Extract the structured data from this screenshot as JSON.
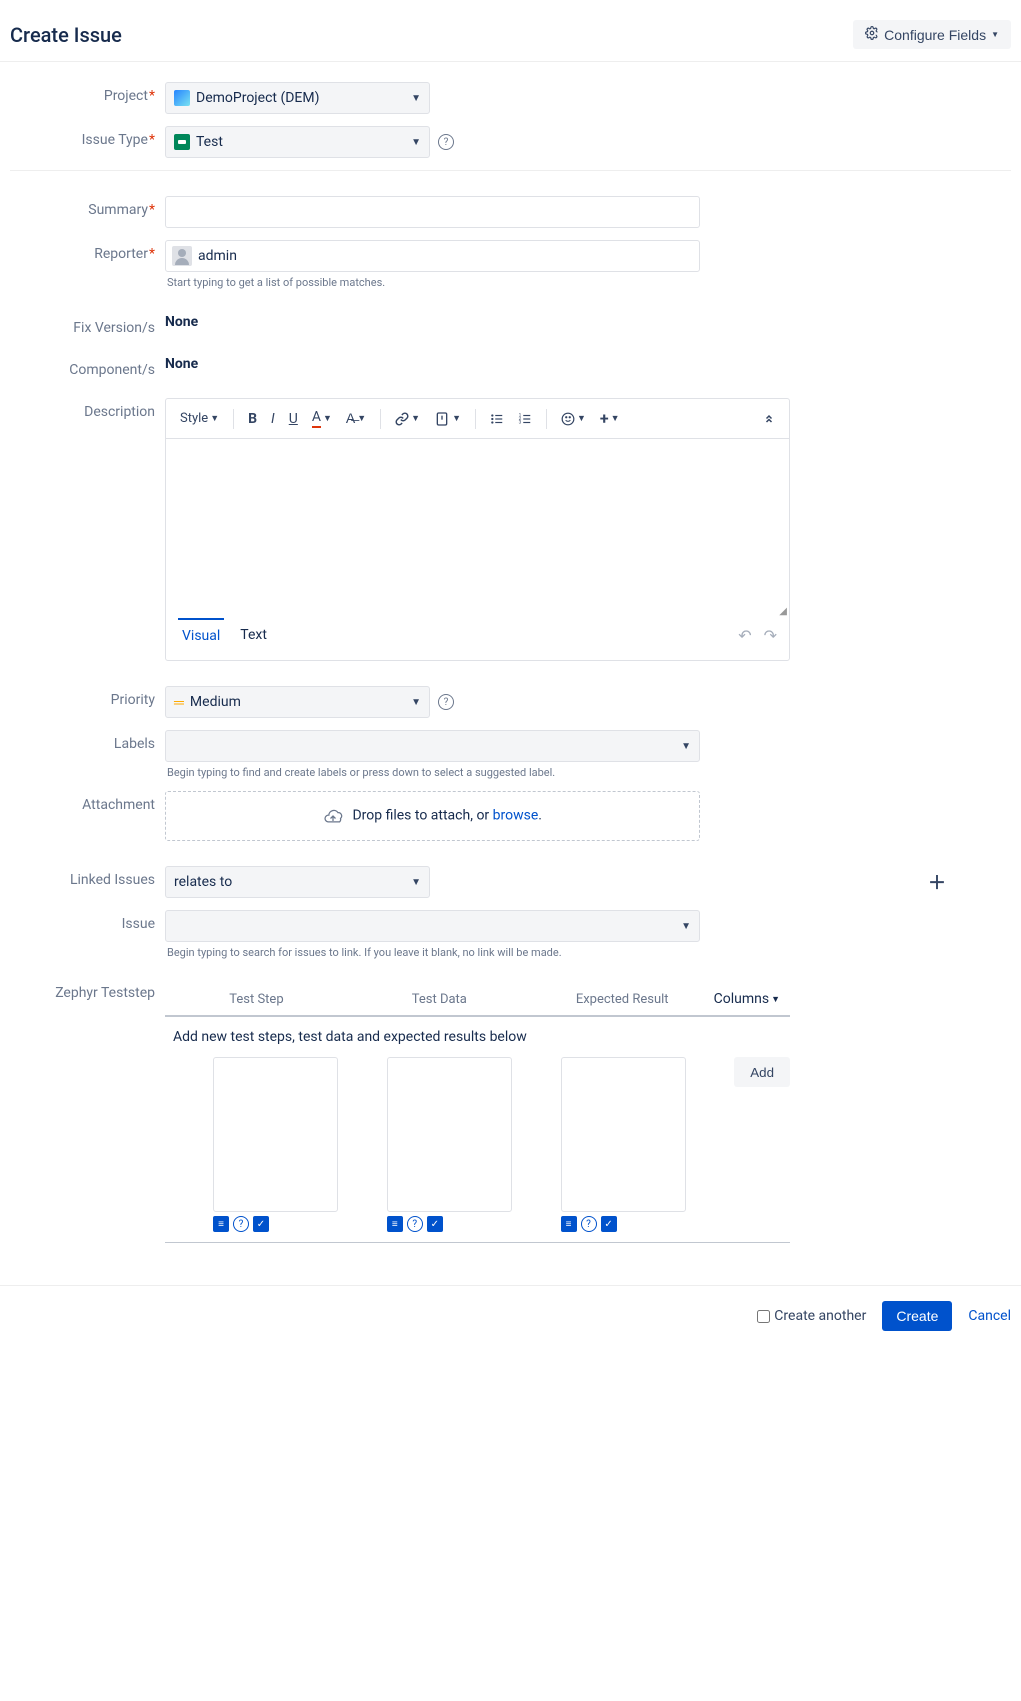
{
  "header": {
    "title": "Create Issue",
    "configure_fields": "Configure Fields"
  },
  "fields": {
    "project": {
      "label": "Project",
      "value": "DemoProject (DEM)"
    },
    "issue_type": {
      "label": "Issue Type",
      "value": "Test"
    },
    "summary": {
      "label": "Summary",
      "value": ""
    },
    "reporter": {
      "label": "Reporter",
      "value": "admin",
      "help": "Start typing to get a list of possible matches."
    },
    "fix_versions": {
      "label": "Fix Version/s",
      "value": "None"
    },
    "components": {
      "label": "Component/s",
      "value": "None"
    },
    "description": {
      "label": "Description"
    },
    "priority": {
      "label": "Priority",
      "value": "Medium"
    },
    "labels": {
      "label": "Labels",
      "help": "Begin typing to find and create labels or press down to select a suggested label."
    },
    "attachment": {
      "label": "Attachment",
      "text": "Drop files to attach, or ",
      "link": "browse"
    },
    "linked_issues": {
      "label": "Linked Issues",
      "value": "relates to"
    },
    "issue": {
      "label": "Issue",
      "help": "Begin typing to search for issues to link. If you leave it blank, no link will be made."
    },
    "zephyr": {
      "label": "Zephyr Teststep",
      "headers": [
        "Test Step",
        "Test Data",
        "Expected Result"
      ],
      "columns_btn": "Columns",
      "hint": "Add new test steps, test data and expected results below",
      "add": "Add"
    }
  },
  "editor": {
    "style": "Style",
    "tabs": {
      "visual": "Visual",
      "text": "Text"
    }
  },
  "footer": {
    "create_another": "Create another",
    "create": "Create",
    "cancel": "Cancel"
  }
}
